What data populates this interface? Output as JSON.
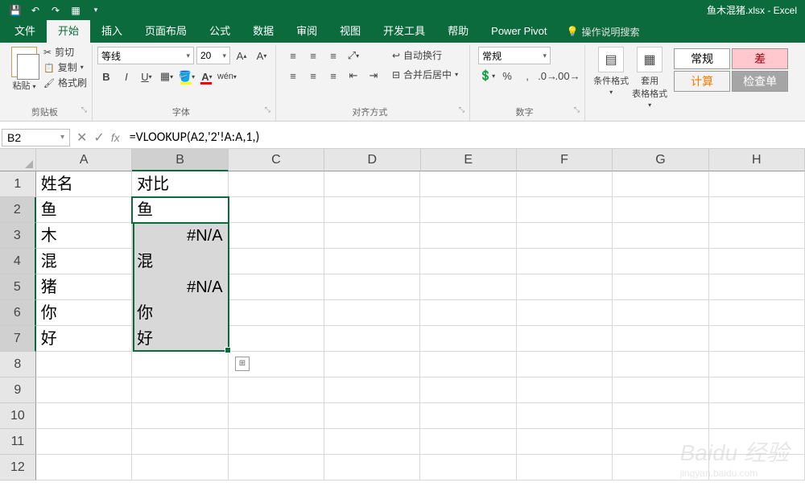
{
  "title": "鱼木混猪.xlsx - Excel",
  "tabs": {
    "file": "文件",
    "home": "开始",
    "insert": "插入",
    "layout": "页面布局",
    "formulas": "公式",
    "data": "数据",
    "review": "审阅",
    "view": "视图",
    "dev": "开发工具",
    "help": "帮助",
    "pivot": "Power Pivot",
    "tellme": "操作说明搜索"
  },
  "clipboard": {
    "paste": "粘贴",
    "cut": "剪切",
    "copy": "复制",
    "painter": "格式刷",
    "label": "剪贴板"
  },
  "font": {
    "name": "等线",
    "size": "20",
    "label": "字体"
  },
  "align": {
    "wrap": "自动换行",
    "merge": "合并后居中",
    "label": "对齐方式"
  },
  "number": {
    "format": "常规",
    "label": "数字"
  },
  "styles": {
    "cond": "条件格式",
    "table": "套用\n表格格式",
    "normal": "常规",
    "bad": "差",
    "calc": "计算",
    "check": "检查单"
  },
  "namebox": "B2",
  "formula": "=VLOOKUP(A2,'2'!A:A,1,)",
  "cols": [
    "A",
    "B",
    "C",
    "D",
    "E",
    "F",
    "G",
    "H"
  ],
  "rows": [
    "1",
    "2",
    "3",
    "4",
    "5",
    "6",
    "7",
    "8",
    "9",
    "10",
    "11",
    "12"
  ],
  "cells": {
    "A1": "姓名",
    "B1": "对比",
    "A2": "鱼",
    "B2": "鱼",
    "A3": "木",
    "B3": "#N/A",
    "A4": "混",
    "B4": "混",
    "A5": "猪",
    "B5": "#N/A",
    "A6": "你",
    "B6": "你",
    "A7": "好",
    "B7": "好"
  },
  "watermark": {
    "brand": "Baidu 经验",
    "url": "jingyan.baidu.com"
  }
}
